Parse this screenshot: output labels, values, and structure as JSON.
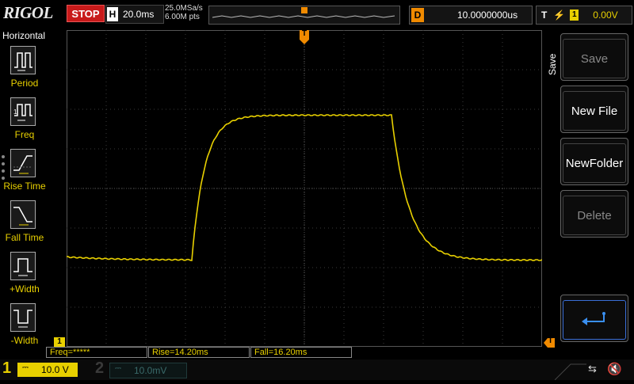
{
  "top": {
    "logo": "RIGOL",
    "run_state": "STOP",
    "timebase_label": "H",
    "timebase_value": "20.0ms",
    "sample_rate": "25.0MSa/s",
    "memory_depth": "6.00M pts",
    "trigger_marker": "T",
    "delay_label": "D",
    "delay_value": "10.0000000us",
    "trigger_label": "T",
    "trigger_channel": "1",
    "trigger_level": "0.00V"
  },
  "left_panel": {
    "title": "Horizontal",
    "items": [
      {
        "label": "Period",
        "icon": "period-icon"
      },
      {
        "label": "Freq",
        "icon": "freq-icon"
      },
      {
        "label": "Rise Time",
        "icon": "rise-time-icon"
      },
      {
        "label": "Fall Time",
        "icon": "fall-time-icon"
      },
      {
        "label": "+Width",
        "icon": "positive-width-icon"
      },
      {
        "label": "-Width",
        "icon": "negative-width-icon"
      }
    ]
  },
  "grid": {
    "ch1_marker": "1",
    "trigger_level_marker": "T",
    "top_trigger_marker": "T"
  },
  "right_panel": {
    "title": "Save",
    "buttons": [
      {
        "label": "Save",
        "enabled": false
      },
      {
        "label": "New File",
        "enabled": true
      },
      {
        "label": "NewFolder",
        "enabled": true
      },
      {
        "label": "Delete",
        "enabled": false
      },
      {
        "label": "",
        "icon": "return-arrow-icon",
        "enabled": true
      }
    ]
  },
  "measurements": {
    "freq": "Freq=*****",
    "rise": "Rise=14.20ms",
    "fall": "Fall=16.20ms"
  },
  "status": {
    "ch1_number": "1",
    "ch1_scale": "10.0 V",
    "ch2_number": "2",
    "ch2_scale": "10.0mV"
  },
  "colors": {
    "ch1": "#e8d000",
    "trigger": "#f08a00",
    "stop": "#c81a1a",
    "grid": "#555555",
    "return_icon": "#3a6fd8"
  }
}
